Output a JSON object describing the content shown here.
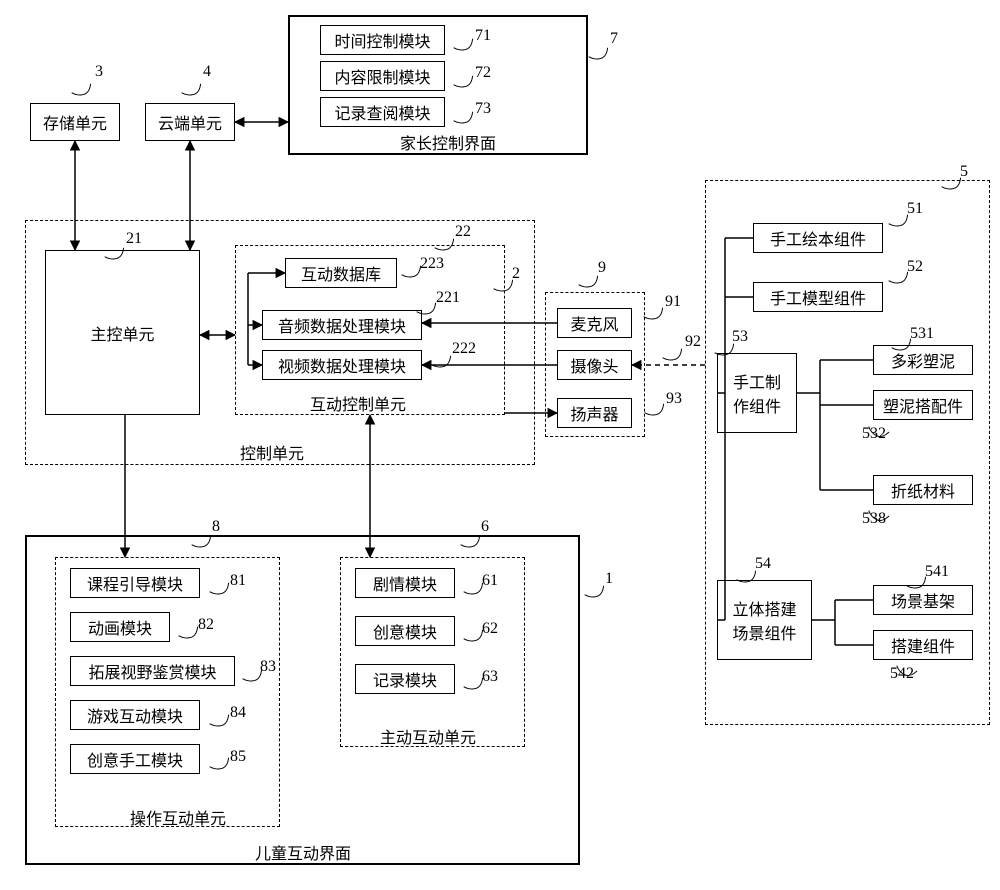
{
  "n3": "存储单元",
  "n4": "云端单元",
  "g7_title": "家长控制界面",
  "n71": "时间控制模块",
  "n72": "内容限制模块",
  "n73": "记录查阅模块",
  "g2_title": "控制单元",
  "n21": "主控单元",
  "g22_title": "互动控制单元",
  "n221": "音频数据处理模块",
  "n222": "视频数据处理模块",
  "n223": "互动数据库",
  "n91": "麦克风",
  "n92": "摄像头",
  "n93": "扬声器",
  "g1_title": "儿童互动界面",
  "g8_title": "操作互动单元",
  "n81": "课程引导模块",
  "n82": "动画模块",
  "n83": "拓展视野鉴赏模块",
  "n84": "游戏互动模块",
  "n85": "创意手工模块",
  "g6_title": "主动互动单元",
  "n61": "剧情模块",
  "n62": "创意模块",
  "n63": "记录模块",
  "n51": "手工绘本组件",
  "n52": "手工模型组件",
  "n53": "手工制\n作组件",
  "n531": "多彩塑泥",
  "n532": "塑泥搭配件",
  "n538": "折纸材料",
  "n54": "立体搭建\n场景组件",
  "n541": "场景基架",
  "n542": "搭建组件",
  "num3": "3",
  "num4": "4",
  "num7": "7",
  "num71": "71",
  "num72": "72",
  "num73": "73",
  "num2": "2",
  "num21": "21",
  "num22": "22",
  "num221": "221",
  "num222": "222",
  "num223": "223",
  "num9": "9",
  "num91": "91",
  "num92": "92",
  "num93": "93",
  "num1": "1",
  "num8": "8",
  "num6": "6",
  "num81": "81",
  "num82": "82",
  "num83": "83",
  "num84": "84",
  "num85": "85",
  "num61": "61",
  "num62": "62",
  "num63": "63",
  "num5": "5",
  "num51": "51",
  "num52": "52",
  "num53": "53",
  "num531": "531",
  "num532": "532",
  "num538": "538",
  "num54": "54",
  "num541": "541",
  "num542": "542"
}
